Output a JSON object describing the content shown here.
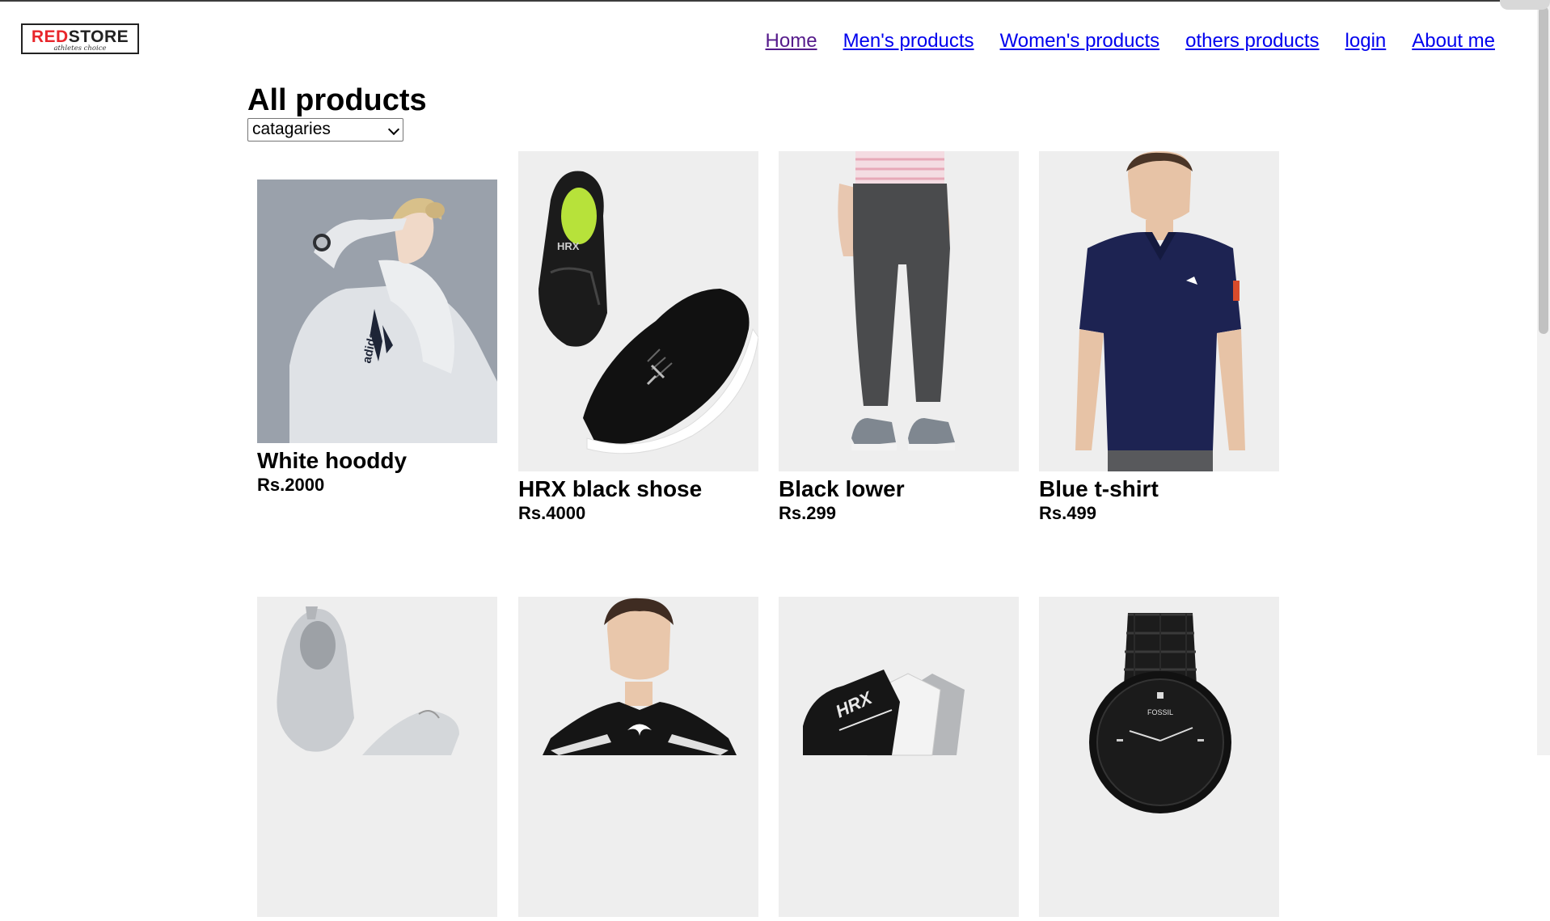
{
  "logo": {
    "red_text": "RED",
    "black_text": "STORE",
    "tagline": "athletes choice"
  },
  "nav": {
    "home": "Home",
    "mens": "Men's products",
    "womens": "Women's products",
    "others": "others products",
    "login": "login",
    "about": "About me"
  },
  "main": {
    "title": "All products",
    "category_select": "catagaries"
  },
  "products": [
    {
      "name": "White hooddy",
      "price": "Rs.2000",
      "brand_text": "adidas"
    },
    {
      "name": "HRX black shose",
      "price": "Rs.4000",
      "brand_text": "HRX"
    },
    {
      "name": "Black lower",
      "price": "Rs.299"
    },
    {
      "name": "Blue t-shirt",
      "price": "Rs.499"
    },
    {
      "name": "",
      "price": ""
    },
    {
      "name": "",
      "price": ""
    },
    {
      "name": "",
      "price": "",
      "brand_text": "HRX"
    },
    {
      "name": "",
      "price": "",
      "brand_text": "FOSSIL"
    }
  ],
  "colors": {
    "link": "#0000ee",
    "visited_link": "#551a8b",
    "logo_red": "#e8262b",
    "product_bg": "#eeeeee"
  },
  "icons": {
    "dropdown": "chevron-down-icon"
  }
}
